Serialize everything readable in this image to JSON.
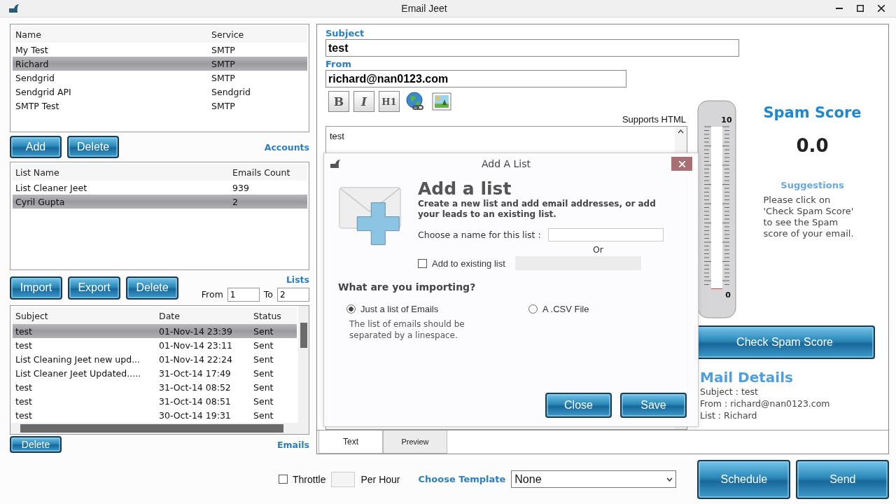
{
  "window": {
    "title": "Email Jeet"
  },
  "accounts": {
    "columns": [
      "Name",
      "Service"
    ],
    "rows": [
      {
        "cells": [
          "My Test",
          "SMTP"
        ],
        "selected": false
      },
      {
        "cells": [
          "Richard",
          "SMTP"
        ],
        "selected": true
      },
      {
        "cells": [
          "Sendgrid",
          "SMTP"
        ],
        "selected": false
      },
      {
        "cells": [
          "Sendgrid API",
          "Sendgrid"
        ],
        "selected": false
      },
      {
        "cells": [
          "SMTP Test",
          "SMTP"
        ],
        "selected": false
      }
    ],
    "buttons": [
      "Add",
      "Delete"
    ],
    "label": "Accounts"
  },
  "lists": {
    "columns": [
      "List Name",
      "Emails Count"
    ],
    "rows": [
      {
        "cells": [
          "List Cleaner Jeet",
          "939"
        ],
        "selected": false
      },
      {
        "cells": [
          "Cyril Gupta",
          "2"
        ],
        "selected": true
      }
    ],
    "buttons": [
      "Import",
      "Export",
      "Delete"
    ],
    "label": "Lists",
    "from_label": "From",
    "from_value": "1",
    "to_label": "To",
    "to_value": "2"
  },
  "emails": {
    "columns": [
      "Subject",
      "Date",
      "Status"
    ],
    "rows": [
      {
        "cells": [
          "test",
          "01-Nov-14 23:39",
          "Sent"
        ],
        "selected": true
      },
      {
        "cells": [
          "test",
          "01-Nov-14 23:11",
          "Sent"
        ],
        "selected": false
      },
      {
        "cells": [
          "List Cleaning Jeet new upd...",
          "01-Nov-14 22:24",
          "Sent"
        ],
        "selected": false
      },
      {
        "cells": [
          "List Cleaner Jeet Updated.....",
          "31-Oct-14 17:49",
          "Sent"
        ],
        "selected": false
      },
      {
        "cells": [
          "test",
          "31-Oct-14 08:52",
          "Sent"
        ],
        "selected": false
      },
      {
        "cells": [
          "test",
          "31-Oct-14 08:51",
          "Sent"
        ],
        "selected": false
      },
      {
        "cells": [
          "test",
          "30-Oct-14 19:31",
          "Sent"
        ],
        "selected": false
      }
    ],
    "buttons": [
      "Delete"
    ],
    "label": "Emails"
  },
  "compose": {
    "subject_label": "Subject",
    "subject": "test",
    "from_label": "From",
    "from": "richard@nan0123.com",
    "toolbar": [
      {
        "kind": "bold",
        "label": "B"
      },
      {
        "kind": "italic",
        "label": "I"
      },
      {
        "kind": "heading",
        "label": "H1"
      },
      {
        "kind": "link"
      },
      {
        "kind": "image"
      }
    ],
    "html_note": "Supports HTML",
    "body": "test",
    "tabs": [
      {
        "label": "Text",
        "selected": true
      },
      {
        "label": "Preview",
        "selected": false
      }
    ]
  },
  "spam": {
    "title": "Spam Score",
    "score": "0.0",
    "level": 0,
    "ticks": [
      "10",
      "0"
    ],
    "suggestions_title": "Suggestions",
    "suggestion": "Please click on 'Check Spam Score' to see the Spam score of your email.",
    "check_button": "Check Spam Score",
    "details_title": "Mail Details",
    "details": [
      "Subject : test",
      "From : richard@nan0123.com",
      "List : Richard"
    ]
  },
  "footer": {
    "throttle": {
      "label": "Throttle",
      "checked": false
    },
    "per_hour": "Per Hour",
    "template_label": "Choose Template",
    "template": "None",
    "buttons": [
      "Schedule",
      "Send"
    ]
  },
  "dialog": {
    "title": "Add A  List",
    "heading": "Add a list",
    "description": "Create a new list and add email addresses, or add your leads to an existing list.",
    "name_label": "Choose a name for this list :",
    "or": "Or",
    "existing": {
      "label": "Add to existing list",
      "checked": false
    },
    "question": "What are you importing?",
    "options": [
      {
        "label": "Just a list of Emails",
        "selected": true
      },
      {
        "label": "A .CSV File",
        "selected": false
      }
    ],
    "hint": "The list of emails should be separated by a linespace.",
    "buttons": [
      "Close",
      "Save"
    ]
  }
}
